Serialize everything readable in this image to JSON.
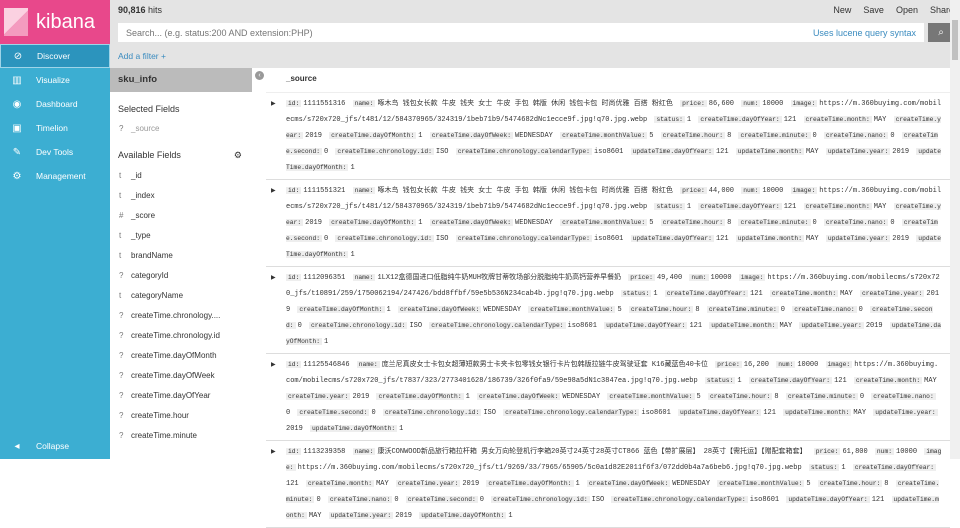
{
  "app": {
    "logo": "kibana"
  },
  "nav": {
    "items": [
      {
        "icon": "compass-icon",
        "glyph": "⊘",
        "label": "Discover"
      },
      {
        "icon": "bar-chart-icon",
        "glyph": "▥",
        "label": "Visualize"
      },
      {
        "icon": "dashboard-icon",
        "glyph": "◉",
        "label": "Dashboard"
      },
      {
        "icon": "shield-icon",
        "glyph": "▣",
        "label": "Timelion"
      },
      {
        "icon": "wrench-icon",
        "glyph": "✎",
        "label": "Dev Tools"
      },
      {
        "icon": "gear-icon",
        "glyph": "⚙",
        "label": "Management"
      }
    ],
    "collapse": "Collapse"
  },
  "header": {
    "hits_count": "90,816",
    "hits_label": "hits",
    "menu": [
      "New",
      "Save",
      "Open",
      "Share"
    ],
    "search_placeholder": "Search... (e.g. status:200 AND extension:PHP)",
    "lucene": "Uses lucene query syntax",
    "add_filter": "Add a filter +"
  },
  "sidebar": {
    "index": "sku_info",
    "selected_title": "Selected Fields",
    "selected": [
      {
        "type": "?",
        "name": "_source"
      }
    ],
    "available_title": "Available Fields",
    "fields": [
      {
        "type": "t",
        "name": "_id"
      },
      {
        "type": "t",
        "name": "_index"
      },
      {
        "type": "#",
        "name": "_score"
      },
      {
        "type": "t",
        "name": "_type"
      },
      {
        "type": "t",
        "name": "brandName"
      },
      {
        "type": "?",
        "name": "categoryId"
      },
      {
        "type": "t",
        "name": "categoryName"
      },
      {
        "type": "?",
        "name": "createTime.chronology...."
      },
      {
        "type": "?",
        "name": "createTime.chronology.id"
      },
      {
        "type": "?",
        "name": "createTime.dayOfMonth"
      },
      {
        "type": "?",
        "name": "createTime.dayOfWeek"
      },
      {
        "type": "?",
        "name": "createTime.dayOfYear"
      },
      {
        "type": "?",
        "name": "createTime.hour"
      },
      {
        "type": "?",
        "name": "createTime.minute"
      }
    ]
  },
  "table": {
    "column": "_source",
    "docs": [
      {
        "id": "1111551316",
        "name": "啄木鸟 钱包女长款 牛皮 钱夹 女士 牛皮 手包 韩版 休闲 钱包卡包 时尚优雅 百搭 粉红色",
        "price": "86,600",
        "num": "10000",
        "image": "https://m.360buyimg.com/mobilecms/s720x720_jfs/t481/12/584370965/324319/1beb71b9/5474682dNc1ecce9f.jpg!q70.jpg.webp"
      },
      {
        "id": "1111551321",
        "name": "啄木鸟 钱包女长款 牛皮 钱夹 女士 牛皮 手包 韩版 休闲 钱包卡包 时尚优雅 百搭 粉红色",
        "price": "44,000",
        "num": "10000",
        "image": "https://m.360buyimg.com/mobilecms/s720x720_jfs/t481/12/584370965/324319/1beb71b9/5474682dNc1ecce9f.jpg!q70.jpg.webp"
      },
      {
        "id": "1112096351",
        "name": "1LX12盒德国进口低脂纯牛奶MUH牧牌甘蒂牧场部分脱脂纯牛奶高钙营养早餐奶",
        "price": "49,400",
        "num": "10000",
        "image": "https://m.360buyimg.com/mobilecms/s720x720_jfs/t10891/259/1750062194/247426/bdd8ffbf/59e5b536N234cab4b.jpg!q70.jpg.webp"
      },
      {
        "id": "11125546846",
        "name": "庞兰尼真皮女士卡包女超薄短款男士卡夹卡包零钱女银行卡片包韩版拉链牛皮驾驶证套 K16藏蓝色40卡位",
        "price": "16,200",
        "num": "10000",
        "image": "https://m.360buyimg.com/mobilecms/s720x720_jfs/t7837/323/2773401628/186739/326f0fa9/59e98a5dN1c3847ea.jpg!q70.jpg.webp"
      },
      {
        "id": "1113239358",
        "name": "康沃CONWOOD新品旅行箱拉杆箱 男女万向轮登机行李箱20英寸24英寸28英寸CT866 蓝色【带扩展层】 28英寸【需托运】【赠配套箱套】",
        "price": "61,800",
        "num": "10000",
        "image": "https://m.360buyimg.com/mobilecms/s720x720_jfs/t1/9269/33/7965/65905/5c0a1d82E2011f6f3/072dd0b4a7a6beb6.jpg!q70.jpg.webp"
      }
    ],
    "common": [
      [
        "status:",
        "1"
      ],
      [
        "createTime.dayOfYear:",
        "121"
      ],
      [
        "createTime.month:",
        "MAY"
      ],
      [
        "createTime.year:",
        "2019"
      ],
      [
        "createTime.dayOfMonth:",
        "1"
      ],
      [
        "createTime.dayOfWeek:",
        "WEDNESDAY"
      ],
      [
        "createTime.monthValue:",
        "5"
      ],
      [
        "createTime.hour:",
        "8"
      ],
      [
        "createTime.minute:",
        "0"
      ],
      [
        "createTime.nano:",
        "0"
      ],
      [
        "createTime.second:",
        "0"
      ],
      [
        "createTime.chronology.id:",
        "ISO"
      ],
      [
        "createTime.chronology.calendarType:",
        "iso8601"
      ],
      [
        "updateTime.dayOfYear:",
        "121"
      ],
      [
        "updateTime.month:",
        "MAY"
      ],
      [
        "updateTime.year:",
        "2019"
      ],
      [
        "updateTime.dayOfMonth:",
        "1"
      ]
    ],
    "labels": {
      "id": "id:",
      "name": "name:",
      "price": "price:",
      "num": "num:",
      "image": "image:"
    }
  }
}
